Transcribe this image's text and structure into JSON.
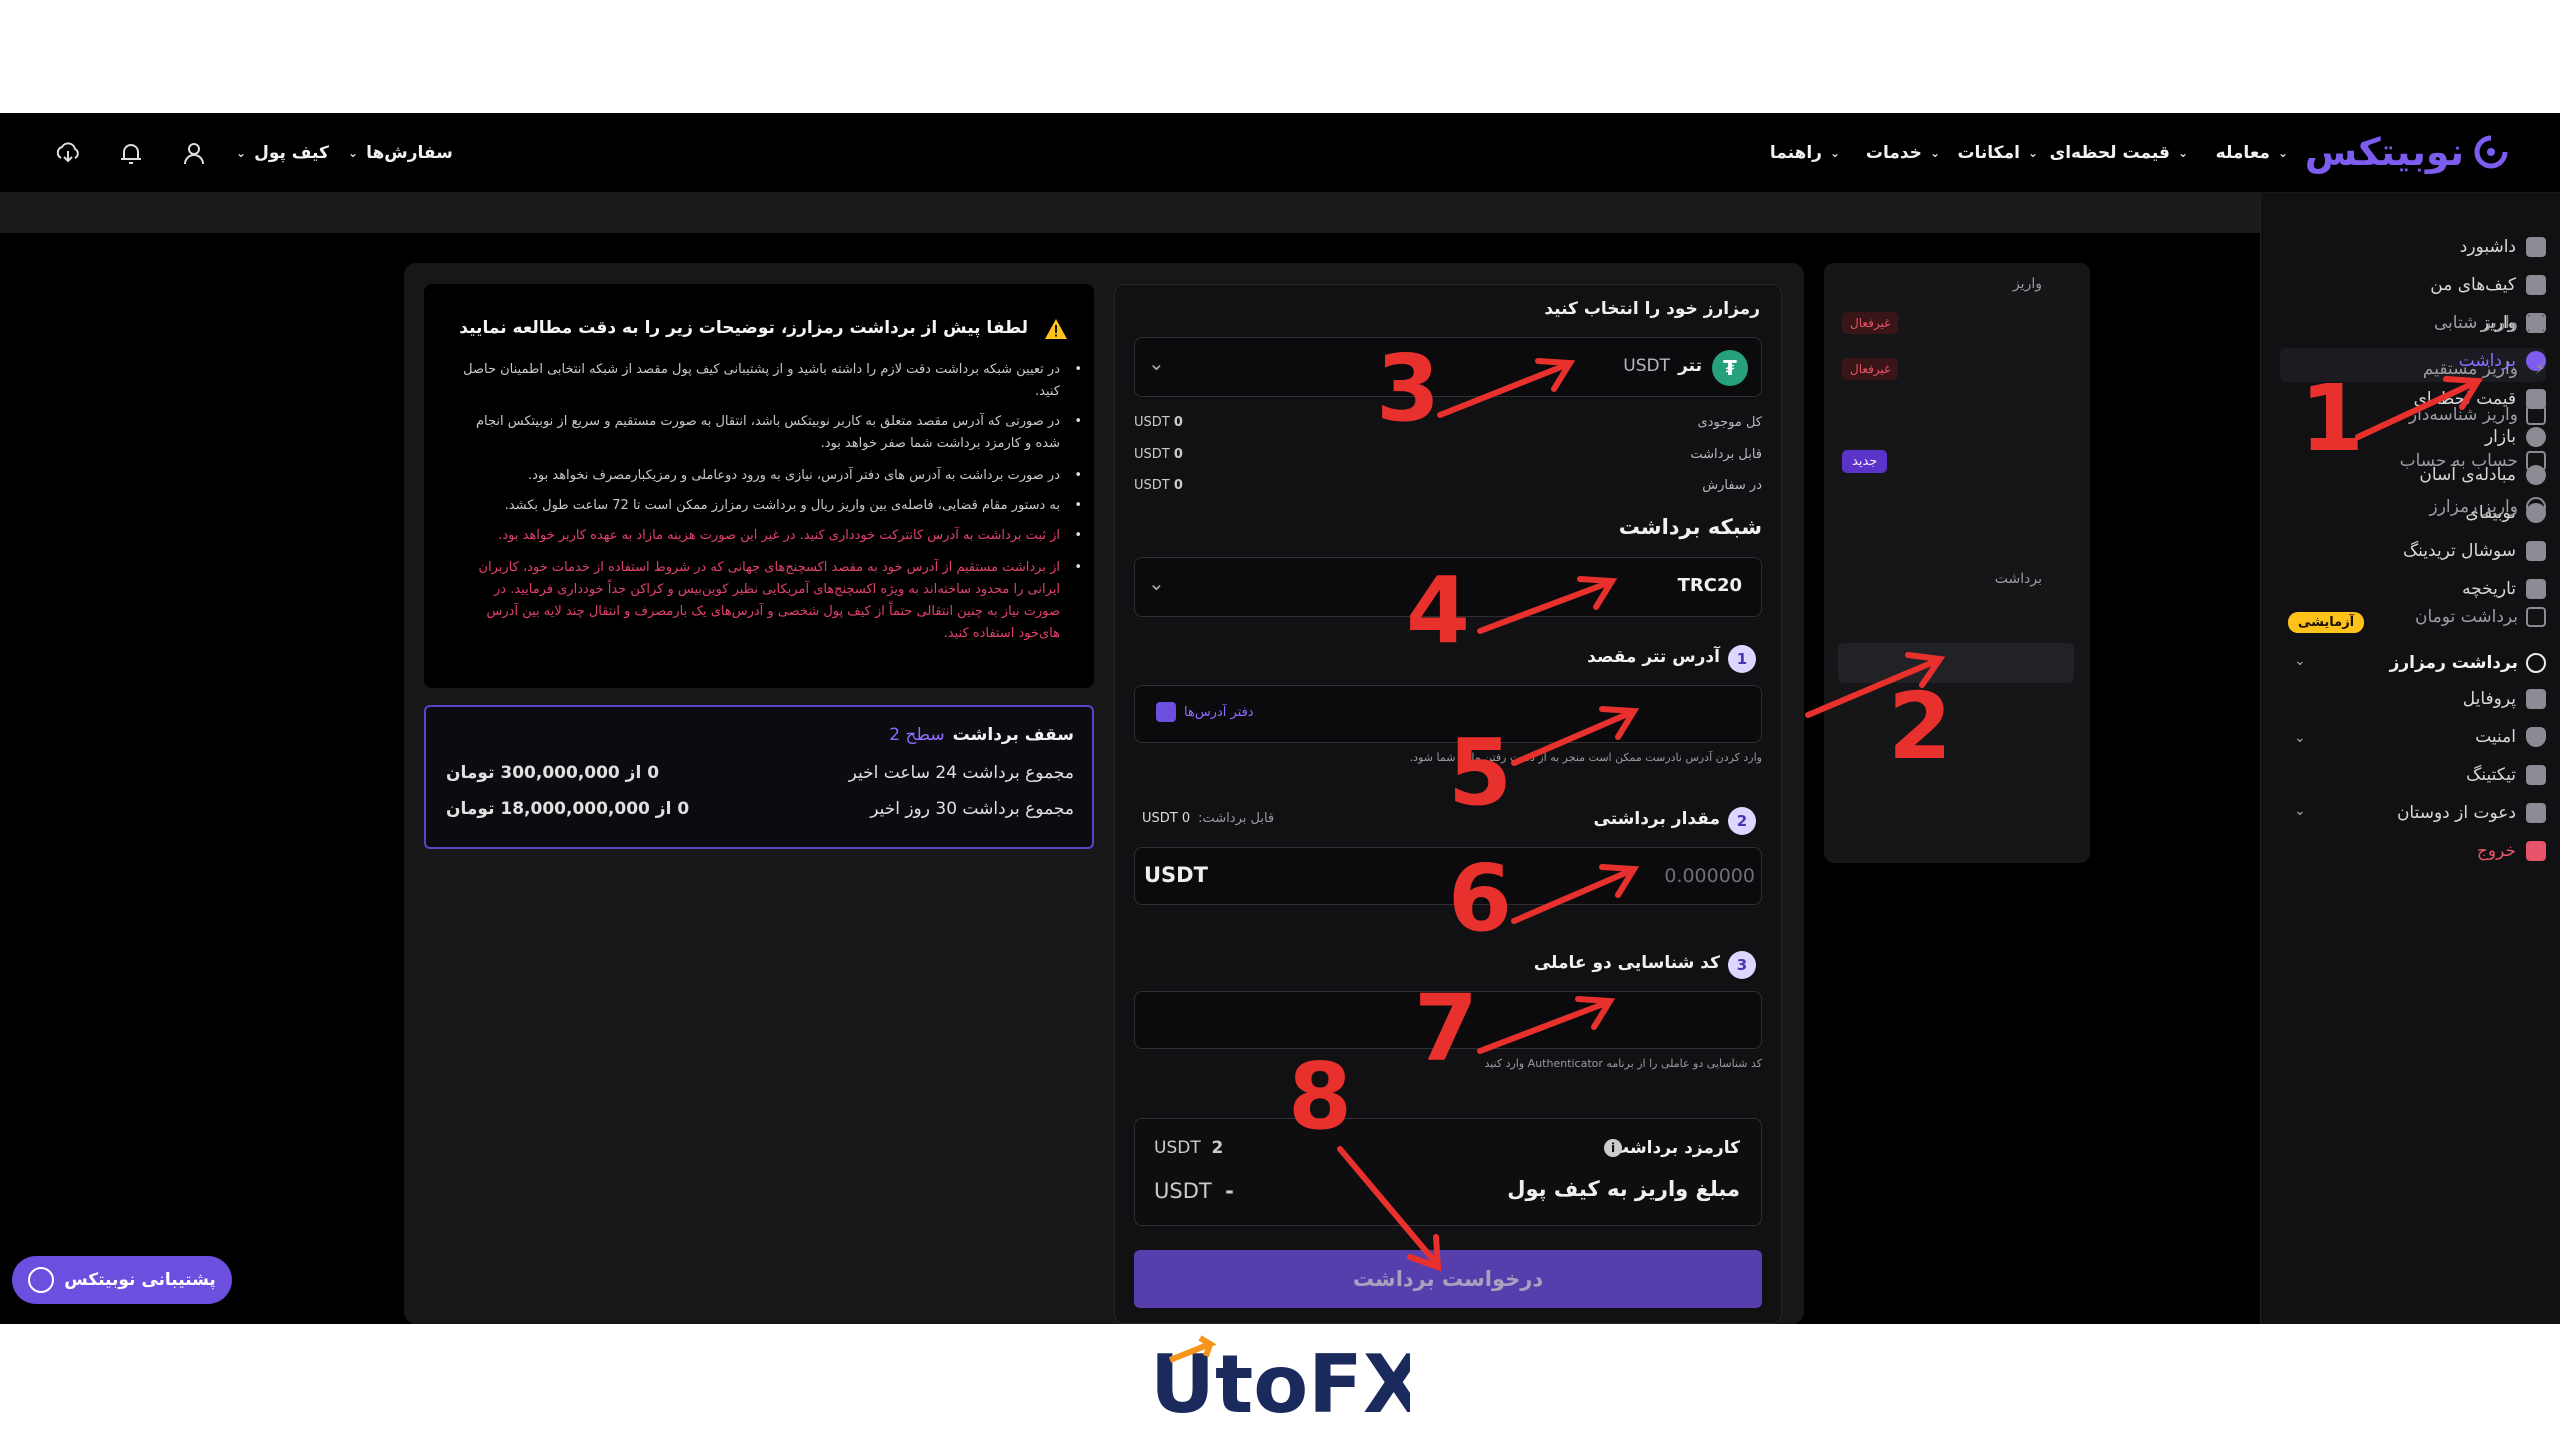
{
  "nav": {
    "logo": "نوبیتکس",
    "items": [
      {
        "label": "معامله"
      },
      {
        "label": "قیمت لحظه‌ای"
      },
      {
        "label": "امکانات"
      },
      {
        "label": "خدمات"
      },
      {
        "label": "راهنما"
      }
    ],
    "orders": "سفارش‌ها",
    "wallet": "کیف پول"
  },
  "sidebar": {
    "items": [
      {
        "label": "داشبورد"
      },
      {
        "label": "کیف‌های من"
      },
      {
        "label": "واریز"
      },
      {
        "label": "برداشت"
      },
      {
        "label": "قیمت لحظه‌ای"
      },
      {
        "label": "بازار"
      },
      {
        "label": "مبادله‌ی آسان"
      },
      {
        "label": "نوبیفای"
      },
      {
        "label": "سوشال تریدینگ"
      },
      {
        "label": "تاریخچه"
      },
      {
        "label": "پروفایل"
      },
      {
        "label": "امنیت"
      },
      {
        "label": "تیکتینگ"
      },
      {
        "label": "دعوت از دوستان"
      },
      {
        "label": "خروج"
      }
    ],
    "trial_badge": "آزمایشی"
  },
  "submenu": {
    "deposit_head": "واریز",
    "deposit_items": [
      {
        "label": "واریز شتابی",
        "badge": "غیرفعال"
      },
      {
        "label": "واریز مستقیم",
        "badge": "غیرفعال"
      },
      {
        "label": "واریز شناسه‌دار",
        "badge": ""
      },
      {
        "label": "حساب به حساب",
        "badge": "جدید"
      },
      {
        "label": "واریز رمزارز",
        "badge": ""
      }
    ],
    "withdraw_head": "برداشت",
    "withdraw_items": [
      {
        "label": "برداشت تومان"
      },
      {
        "label": "برداشت رمزارز"
      }
    ]
  },
  "form": {
    "choose_currency": "رمزارز خود را انتخاب کنید",
    "currency_name": "تتر",
    "currency_code": "USDT",
    "balances": [
      {
        "label": "کل موجودی",
        "value": "0",
        "unit": "USDT"
      },
      {
        "label": "قابل برداشت",
        "value": "0",
        "unit": "USDT"
      },
      {
        "label": "در سفارش",
        "value": "0",
        "unit": "USDT"
      }
    ],
    "network_title": "شبکه برداشت",
    "network_value": "TRC20",
    "step1": "1",
    "address_label": "آدرس تتر مقصد",
    "address_book": "دفتر آدرس‌ها",
    "address_note": "وارد کردن آدرس نادرست ممکن است منجر به از دست رفتن مالی شما شود.",
    "step2": "2",
    "amount_label": "مقدار برداشتی",
    "withdrawable_label": "قابل برداشت:",
    "withdrawable_value": "USDT 0",
    "amount_placeholder": "0.000000",
    "amount_unit": "USDT",
    "step3": "3",
    "twofa_label": "کد شناسایی دو عاملی",
    "twofa_note": "کد شناسایی دو عاملی را از برنامه Authenticator وارد کنید",
    "fee_label": "کارمزد برداشت",
    "fee_value": "2",
    "fee_unit": "USDT",
    "receive_label": "مبلغ واریز به کیف پول",
    "receive_value": "-",
    "receive_unit": "USDT",
    "submit": "درخواست برداشت"
  },
  "info": {
    "title": "لطفا پیش از برداشت رمزارز، توضیحات زیر را به دقت مطالعه نمایید",
    "bullets": [
      {
        "text": "در تعیین شبکه برداشت دقت لازم را داشته باشید و از پشتیبانی کیف پول مقصد از شبکه انتخابی اطمینان حاصل کنید.",
        "red": false
      },
      {
        "text": "در صورتی که آدرس مقصد متعلق به کاربر نوبیتکس باشد، انتقال به صورت مستقیم و سریع از نوبیتکس انجام شده و کارمزد برداشت شما صفر خواهد بود.",
        "red": false
      },
      {
        "text": "در صورت برداشت به آدرس های دفتر آدرس، نیازی به ورود دوعاملی و رمزیکبارمصرف نخواهد بود.",
        "red": false
      },
      {
        "text": "به دستور مقام قضایی، فاصله‌ی بین واریز ریال و برداشت رمزارز ممکن است تا 72 ساعت طول بکشد.",
        "red": false
      },
      {
        "text": "از ثبت برداشت به آدرس کانترکت خودداری کنید. در غیر این صورت هزینه مازاد به عهده کاربر خواهد بود.",
        "red": true
      },
      {
        "text": "از برداشت مستقیم از آدرس خود به مقصد اکسچنج‌های جهانی که در شروط استفاده از خدمات خود، کاربران ایرانی را محدود ساخته‌اند به ویژه اکسچنج‌های آمریکایی نظیر کوین‌بیس و کراکن جداً خودداری فرمایید. در صورت نیاز به چنین انتقالی حتماً از کیف پول شخصی و آدرس‌های یک بارمصرف و انتقال چند لایه بین آدرس های‌خود استفاده کنید.",
        "red": true
      }
    ]
  },
  "limits": {
    "title": "سقف برداشت",
    "level": "سطح 2",
    "rows": [
      {
        "label": "مجموع برداشت 24 ساعت اخیر",
        "value": "0 از 300,000,000 تومان"
      },
      {
        "label": "مجموع برداشت 30 روز اخیر",
        "value": "0 از 18,000,000,000 تومان"
      }
    ]
  },
  "support": "پشتیبانی نوبیتکس",
  "annotations": [
    "1",
    "2",
    "3",
    "4",
    "5",
    "6",
    "7",
    "8"
  ],
  "watermark": "UtoFX",
  "colors": {
    "accent": "#6d4fe0",
    "annotation": "#e8302d",
    "warning": "#ffc21a",
    "danger": "#e2416b"
  }
}
